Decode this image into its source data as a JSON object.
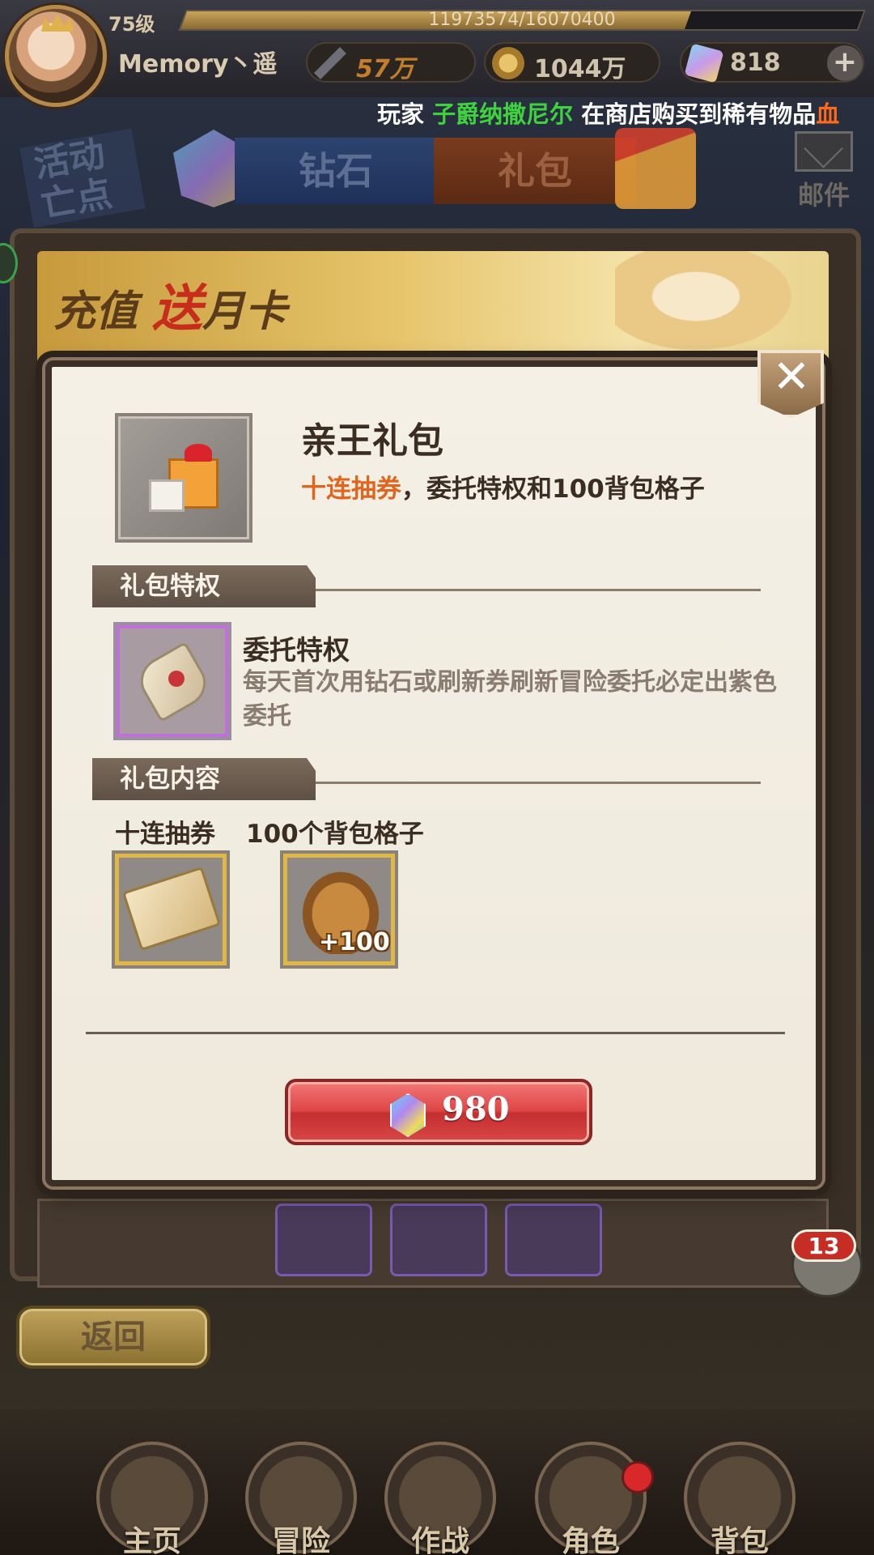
{
  "player": {
    "level": "75级",
    "exp": "11973574/16070400",
    "exp_progress": 0.745,
    "name": "Memory丶遥",
    "power": "57万",
    "gold": "1044万",
    "gems": "818"
  },
  "broadcast": {
    "prefix": "玩家",
    "player": "子爵纳撒尼尔",
    "text": "在商店购买到稀有物品",
    "item": "血"
  },
  "shop": {
    "event_stamp": "活动\n亡点",
    "tabs": [
      "钻石",
      "礼包"
    ],
    "mail_label": "邮件",
    "banner_prefix": "充值",
    "banner_highlight": "送",
    "banner_suffix": "月卡"
  },
  "modal": {
    "close_symbol": "✕",
    "title": "亲王礼包",
    "desc_highlight": "十连抽券",
    "desc_rest": "，委托特权和100背包格子",
    "privilege_header": "礼包特权",
    "privilege_title": "委托特权",
    "privilege_desc": "每天首次用钻石或刷新券刷新冒险委托必定出紫色委托",
    "content_header": "礼包内容",
    "contents": [
      {
        "label": "十连抽券"
      },
      {
        "label": "100个背包格子",
        "count": "+100"
      }
    ],
    "price": "980"
  },
  "chat": {
    "count": "13"
  },
  "back_label": "返回",
  "nav": [
    "主页",
    "冒险",
    "作战",
    "角色",
    "背包"
  ],
  "colors": {
    "accent_orange": "#e0651e",
    "broadcast_green": "#3ed23e",
    "buy_red": "#df4545"
  }
}
